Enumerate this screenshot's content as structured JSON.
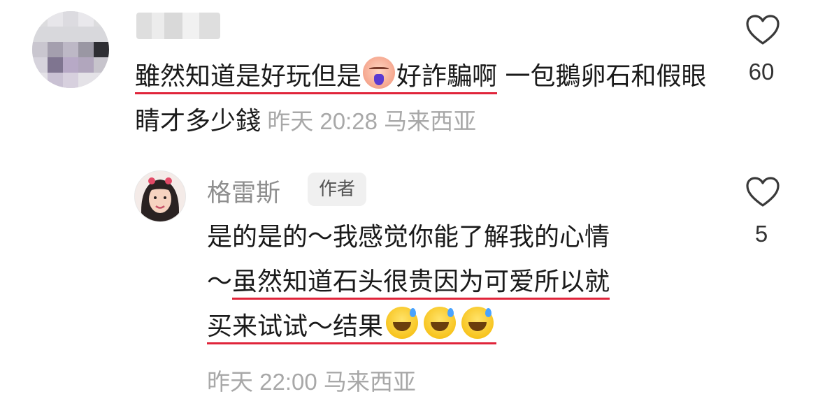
{
  "comment": {
    "text_pre": "雖然知道是好玩但是",
    "text_post": "好詐騙啊",
    "text_rest": " 一包鵝卵石和假眼睛才多少錢",
    "emoji": "crying-face-emoji",
    "time": "昨天 20:28",
    "location": "马来西亚",
    "likes": "60"
  },
  "reply": {
    "author": "格雷斯",
    "badge": "作者",
    "line1": "是的是的～我感觉你能了解我的心情",
    "line2_pre": "～",
    "line2_ul": "虽然知道石头很贵因为可爱所以就",
    "line3_ul": "买来试试～结果",
    "emoji": "grinning-sweat-emoji",
    "time": "昨天 22:00",
    "location": "马来西亚",
    "likes": "5"
  },
  "colors": {
    "underline": "#e0243a",
    "meta": "#a8a8a8"
  }
}
